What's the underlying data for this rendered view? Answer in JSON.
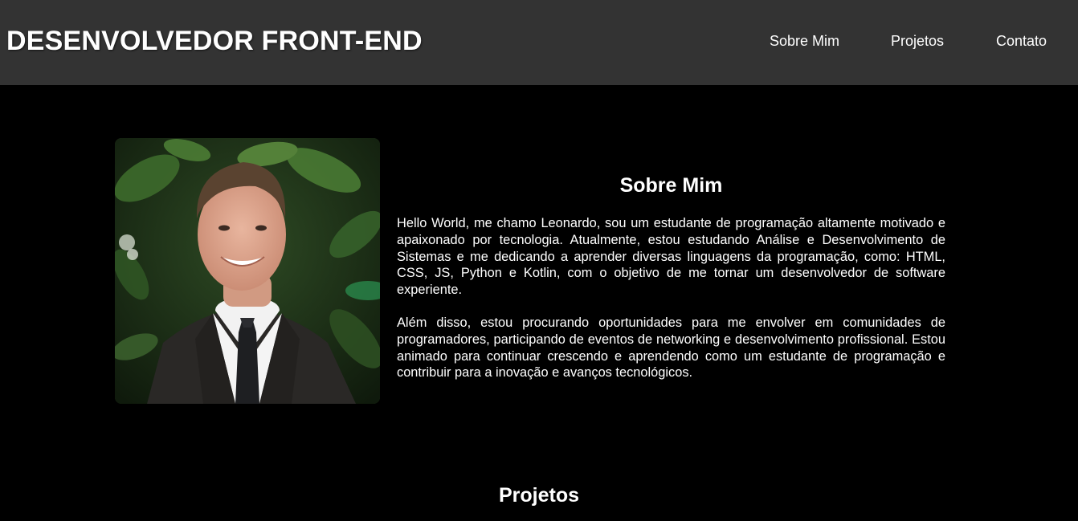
{
  "header": {
    "title": "DESENVOLVEDOR FRONT-END",
    "background": "#333333",
    "nav": [
      {
        "label": "Sobre Mim"
      },
      {
        "label": "Projetos"
      },
      {
        "label": "Contato"
      }
    ]
  },
  "about": {
    "photo_icon": "profile-photo",
    "title": "Sobre Mim",
    "paragraphs": [
      "Hello World, me chamo Leonardo, sou um estudante de programação altamente motivado e apaixonado por tecnologia. Atualmente, estou estudando Análise e Desenvolvimento de Sistemas e me dedicando a aprender diversas linguagens da programação, como: HTML, CSS, JS, Python e Kotlin, com o objetivo de me tornar um desenvolvedor de software experiente.",
      "Além disso, estou procurando oportunidades para me envolver em comunidades de programadores, participando de eventos de networking e desenvolvimento profissional. Estou animado para continuar crescendo e aprendendo como um estudante de programação e contribuir para a inovação e avanços tecnológicos."
    ]
  },
  "projects": {
    "title": "Projetos"
  },
  "colors": {
    "page_background": "#000000",
    "text": "#ffffff"
  }
}
